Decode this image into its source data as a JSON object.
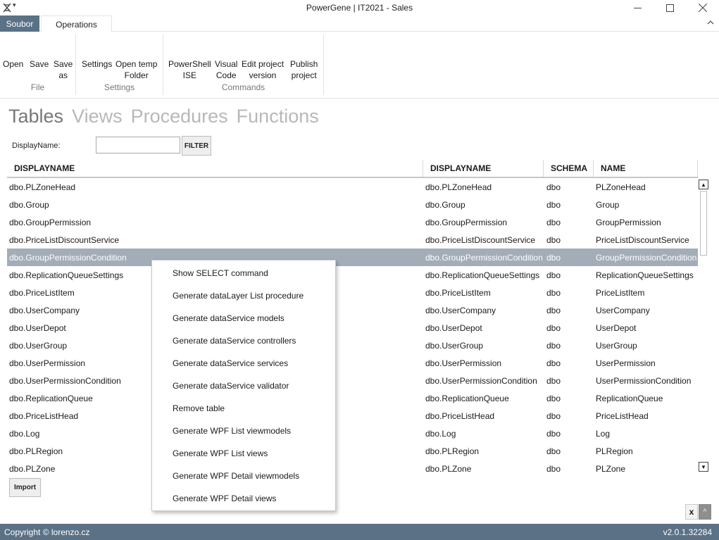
{
  "window": {
    "title": "PowerGene | IT2021 - Sales",
    "controls": [
      "minimize-icon",
      "maximize-icon",
      "close-icon"
    ]
  },
  "ribbon": {
    "tabs": [
      {
        "label": "Soubor",
        "active": false
      },
      {
        "label": "Operations",
        "active": true
      }
    ],
    "groups": [
      {
        "label": "File",
        "buttons": [
          "Open",
          "Save",
          "Save as"
        ]
      },
      {
        "label": "Settings",
        "buttons": [
          "Settings",
          "Open temp Folder"
        ]
      },
      {
        "label": "Commands",
        "buttons": [
          "PowerShell ISE",
          "Visual Code",
          "Edit project version",
          "Publish project"
        ]
      }
    ],
    "btn": {
      "open": "Open",
      "save": "Save",
      "save_as_1": "Save",
      "save_as_2": "as",
      "settings": "Settings",
      "open_temp_1": "Open temp",
      "open_temp_2": "Folder",
      "ps_1": "PowerShell",
      "ps_2": "ISE",
      "vc_1": "Visual",
      "vc_2": "Code",
      "epv_1": "Edit project",
      "epv_2": "version",
      "pub_1": "Publish",
      "pub_2": "project"
    },
    "group_labels": {
      "file": "File",
      "settings": "Settings",
      "commands": "Commands"
    }
  },
  "sections": {
    "tables": "Tables",
    "views": "Views",
    "procedures": "Procedures",
    "functions": "Functions",
    "active": "Tables"
  },
  "filter": {
    "label": "DisplayName:",
    "value": "",
    "button": "FILTER"
  },
  "grid": {
    "headers": [
      "DISPLAYNAME",
      "DISPLAYNAME",
      "SCHEMA",
      "NAME"
    ],
    "selected_index": 4,
    "rows": [
      [
        "dbo.PLZoneHead",
        "dbo.PLZoneHead",
        "dbo",
        "PLZoneHead"
      ],
      [
        "dbo.Group",
        "dbo.Group",
        "dbo",
        "Group"
      ],
      [
        "dbo.GroupPermission",
        "dbo.GroupPermission",
        "dbo",
        "GroupPermission"
      ],
      [
        "dbo.PriceListDiscountService",
        "dbo.PriceListDiscountService",
        "dbo",
        "PriceListDiscountService"
      ],
      [
        "dbo.GroupPermissionCondition",
        "dbo.GroupPermissionCondition",
        "dbo",
        "GroupPermissionCondition"
      ],
      [
        "dbo.ReplicationQueueSettings",
        "dbo.ReplicationQueueSettings",
        "dbo",
        "ReplicationQueueSettings"
      ],
      [
        "dbo.PriceListItem",
        "dbo.PriceListItem",
        "dbo",
        "PriceListItem"
      ],
      [
        "dbo.UserCompany",
        "dbo.UserCompany",
        "dbo",
        "UserCompany"
      ],
      [
        "dbo.UserDepot",
        "dbo.UserDepot",
        "dbo",
        "UserDepot"
      ],
      [
        "dbo.UserGroup",
        "dbo.UserGroup",
        "dbo",
        "UserGroup"
      ],
      [
        "dbo.UserPermission",
        "dbo.UserPermission",
        "dbo",
        "UserPermission"
      ],
      [
        "dbo.UserPermissionCondition",
        "dbo.UserPermissionCondition",
        "dbo",
        "UserPermissionCondition"
      ],
      [
        "dbo.ReplicationQueue",
        "dbo.ReplicationQueue",
        "dbo",
        "ReplicationQueue"
      ],
      [
        "dbo.PriceListHead",
        "dbo.PriceListHead",
        "dbo",
        "PriceListHead"
      ],
      [
        "dbo.Log",
        "dbo.Log",
        "dbo",
        "Log"
      ],
      [
        "dbo.PLRegion",
        "dbo.PLRegion",
        "dbo",
        "PLRegion"
      ],
      [
        "dbo.PLZone",
        "dbo.PLZone",
        "dbo",
        "PLZone"
      ]
    ]
  },
  "import_button": "Import",
  "context_menu": [
    "Show SELECT command",
    "Generate dataLayer List procedure",
    "Generate dataService models",
    "Generate dataService controllers",
    "Generate dataService services",
    "Generate dataService validator",
    "Remove table",
    "Generate WPF List viewmodels",
    "Generate WPF List views",
    "Generate WPF Detail viewmodels",
    "Generate WPF Detail views"
  ],
  "mini_panel": {
    "close_label": "x"
  },
  "status": {
    "copyright": "Copyright © lorenzo.cz",
    "version": "v2.0.1.32284"
  },
  "colors": {
    "accent": "#5a7186",
    "selected_row": "#a3adb8"
  }
}
